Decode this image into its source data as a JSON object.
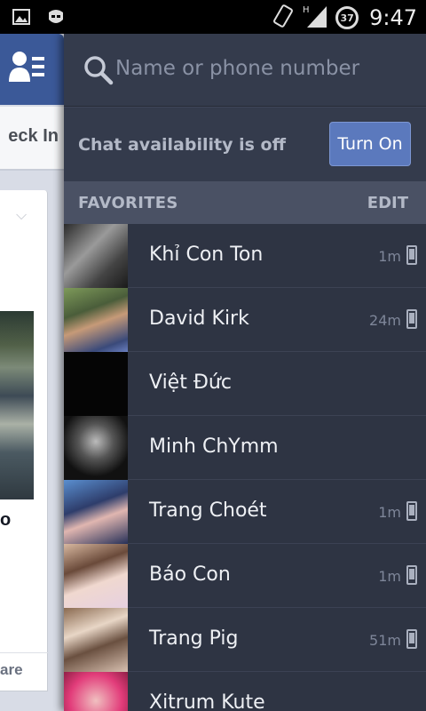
{
  "status_bar": {
    "time": "9:47",
    "battery": "37",
    "network": "H",
    "icons": [
      "image-notification-icon",
      "app-notification-icon",
      "rotation-icon",
      "signal-icon",
      "battery-icon"
    ]
  },
  "background_app": {
    "checkin_label": "eck In",
    "card_partial_text": "o",
    "share_label": "are"
  },
  "chat": {
    "search": {
      "placeholder": "Name or phone number"
    },
    "availability": {
      "text": "Chat availability is off",
      "button": "Turn On"
    },
    "favorites": {
      "title": "FAVORITES",
      "edit": "EDIT",
      "contacts": [
        {
          "name": "Khỉ Con Ton",
          "time": "1m",
          "mobile": true,
          "avatar_bg": "linear-gradient(135deg,#2a2a2a 0%,#9a9a9a 40%,#444 70%,#1a1a1a 100%)"
        },
        {
          "name": "David Kirk",
          "time": "24m",
          "mobile": true,
          "avatar_bg": "linear-gradient(160deg,#7e9a5a 0%,#4a5d3a 35%,#c69a78 55%,#3a4a7a 85%,#6a7fbf 100%)"
        },
        {
          "name": "Việt Đức",
          "time": "",
          "mobile": false,
          "avatar_bg": "#050505"
        },
        {
          "name": "Minh ChYmm",
          "time": "",
          "mobile": false,
          "avatar_bg": "radial-gradient(circle at 50% 40%,#bbb 0%,#555 35%,#111 70%)"
        },
        {
          "name": "Trang Choét",
          "time": "1m",
          "mobile": true,
          "avatar_bg": "linear-gradient(160deg,#5a8fd0 0%,#2e3d6b 40%,#e0b6b0 60%,#263058 100%)"
        },
        {
          "name": "Báo Con",
          "time": "1m",
          "mobile": true,
          "avatar_bg": "linear-gradient(160deg,#d8b8a0 0%,#6a4a3a 35%,#f0d8cf 60%,#e6d0e0 100%)"
        },
        {
          "name": "Trang Pig",
          "time": "51m",
          "mobile": true,
          "avatar_bg": "linear-gradient(160deg,#8a6a50 0%,#e8d6c6 35%,#6a5040 60%,#d8c0b0 100%)"
        },
        {
          "name": "Xitrum Kute",
          "time": "",
          "mobile": false,
          "avatar_bg": "radial-gradient(circle at 50% 45%,#f0c0c0 0%,#e23c7a 55%,#7a1838 100%)"
        }
      ]
    }
  },
  "colors": {
    "sidebar_bg": "#2e3443",
    "header_bg": "#343b4c",
    "fb_blue": "#3b5998",
    "button_blue": "#5b79bd"
  }
}
